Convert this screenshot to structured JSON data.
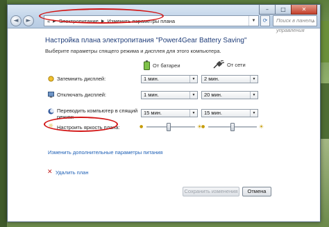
{
  "window": {
    "caption_buttons": {
      "minimize": "–",
      "maximize": "□",
      "close": "✕"
    },
    "nav": {
      "back": "◄",
      "forward": "►"
    },
    "breadcrumb": {
      "root": "«",
      "items": [
        "Электропитание",
        "Изменить параметры плана"
      ]
    },
    "search_placeholder": "Поиск в панели управления"
  },
  "page": {
    "heading": "Настройка плана электропитания \"Power4Gear Battery Saving\"",
    "subtitle": "Выберите параметры спящего режима и дисплея для этого компьютера.",
    "columns": {
      "battery": "От батареи",
      "plugged": "От сети"
    },
    "rows": [
      {
        "label": "Затемнить дисплей:",
        "battery": "1 мин.",
        "plugged": "2 мин."
      },
      {
        "label": "Отключать дисплей:",
        "battery": "1 мин.",
        "plugged": "20 мин."
      },
      {
        "label": "Переводить компьютер в спящий режим:",
        "battery": "15 мин.",
        "plugged": "15 мин."
      }
    ],
    "brightness_label": "Настроить яркость плана:",
    "brightness": {
      "battery": 0.45,
      "plugged": 0.5
    },
    "advanced_link": "Изменить дополнительные параметры питания",
    "delete_link": "Удалить план",
    "save_button": "Сохранить изменения",
    "cancel_button": "Отмена"
  },
  "colors": {
    "highlight": "#d21414",
    "link": "#1d5fb5",
    "heading": "#1e3c78"
  }
}
